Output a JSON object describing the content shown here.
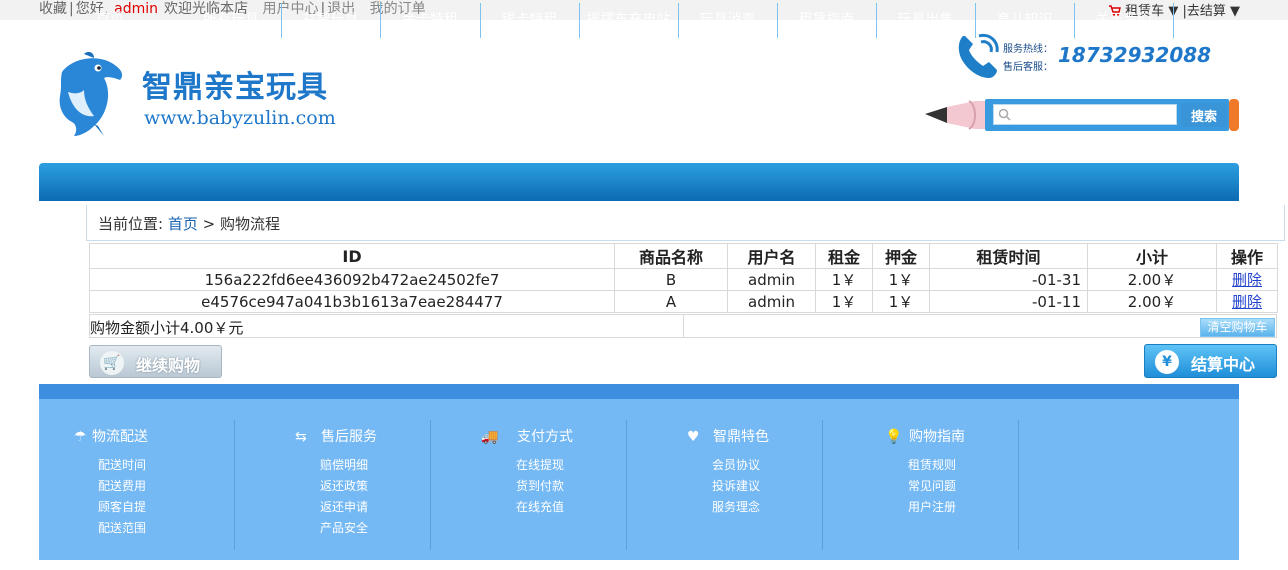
{
  "topbar": {
    "favorite": "收藏",
    "hello": "您好,",
    "username": "admin",
    "welcome": "欢迎光临本店",
    "user_center": "用户中心",
    "logout": "退出",
    "my_orders": "我的订单",
    "cart": "租赁车",
    "checkout": "去结算"
  },
  "header": {
    "brand_name": "智鼎亲宝玩具",
    "brand_url": "www.babyzulin.com",
    "hotline_label": "服务热线：",
    "aftersale_label": "售后客服：",
    "phone": "18732932088",
    "search_placeholder": "",
    "search_button": "搜索"
  },
  "nav": [
    "首页",
    "所有玩具",
    "益智玩具",
    "金卡特租",
    "银卡特租",
    "摇摆车充电站",
    "玩具消毒",
    "租赁指南",
    "玩具出售",
    "育儿知识",
    "关于我们"
  ],
  "breadcrumb": {
    "label": "当前位置:",
    "home": "首页",
    "sep": ">",
    "current": "购物流程"
  },
  "table": {
    "headers": [
      "ID",
      "商品名称",
      "用户名",
      "租金",
      "押金",
      "租赁时间",
      "小计",
      "操作"
    ],
    "rows": [
      {
        "id": "156a222fd6ee436092b472ae24502fe7",
        "name": "B",
        "user": "admin",
        "rent": "1￥",
        "deposit": "1￥",
        "time": "-01-31",
        "subtotal": "2.00￥",
        "action": "删除"
      },
      {
        "id": "e4576ce947a041b3b1613a7eae284477",
        "name": "A",
        "user": "admin",
        "rent": "1￥",
        "deposit": "1￥",
        "time": "-01-11",
        "subtotal": "2.00￥",
        "action": "删除"
      }
    ]
  },
  "summary": {
    "text": "购物金额小计4.00￥元",
    "clear_button": "清空购物车"
  },
  "buttons": {
    "continue": "继续购物",
    "checkout": "结算中心"
  },
  "footer": {
    "columns": [
      {
        "title": "物流配送",
        "icon": "umbrella-icon",
        "links": [
          "配送时间",
          "配送费用",
          "顾客自提",
          "配送范围"
        ]
      },
      {
        "title": "售后服务",
        "icon": "service-icon",
        "links": [
          "赔偿明细",
          "返还政策",
          "返还申请",
          "产品安全"
        ]
      },
      {
        "title": "支付方式",
        "icon": "truck-icon",
        "links": [
          "在线提现",
          "货到付款",
          "在线充值"
        ]
      },
      {
        "title": "智鼎特色",
        "icon": "heart-icon",
        "links": [
          "会员协议",
          "投诉建议",
          "服务理念"
        ]
      },
      {
        "title": "购物指南",
        "icon": "bulb-icon",
        "links": [
          "租赁规则",
          "常见问题",
          "用户注册"
        ]
      }
    ]
  },
  "colors": {
    "accent": "#1e77c9",
    "nav": "#1a86cf",
    "footer": "#74b8f4",
    "username": "#dd0000"
  }
}
